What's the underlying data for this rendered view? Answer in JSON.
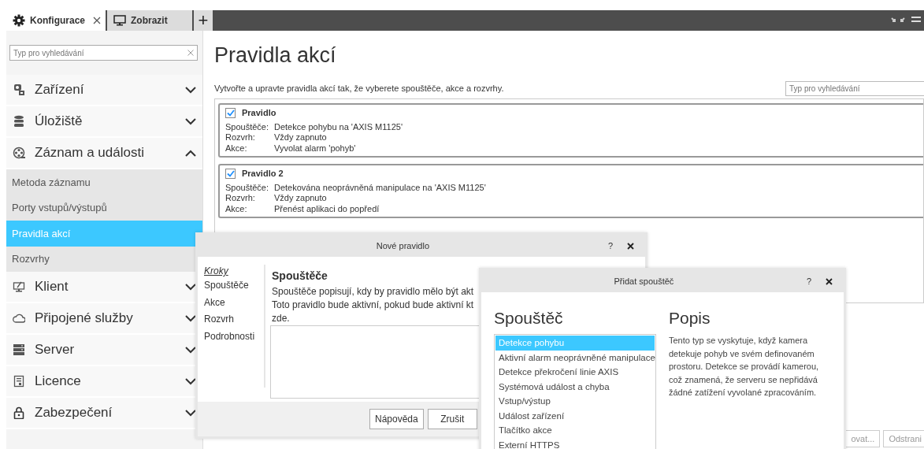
{
  "tabs": [
    {
      "label": "Konfigurace",
      "selected": true,
      "closable": true
    },
    {
      "label": "Zobrazit",
      "selected": false,
      "closable": false
    }
  ],
  "new_tab": "+",
  "sidebar": {
    "search": {
      "placeholder": "Typ pro vyhledávání"
    },
    "sections": [
      {
        "label": "Zařízení",
        "expanded": false
      },
      {
        "label": "Úložiště",
        "expanded": false
      },
      {
        "label": "Záznam a události",
        "expanded": true,
        "children": [
          {
            "label": "Metoda záznamu",
            "selected": false
          },
          {
            "label": "Porty vstupů/výstupů",
            "selected": false
          },
          {
            "label": "Pravidla akcí",
            "selected": true
          },
          {
            "label": "Rozvrhy",
            "selected": false
          }
        ]
      },
      {
        "label": "Klient",
        "expanded": false
      },
      {
        "label": "Připojené služby",
        "expanded": false
      },
      {
        "label": "Server",
        "expanded": false
      },
      {
        "label": "Licence",
        "expanded": false
      },
      {
        "label": "Zabezpečení",
        "expanded": false
      }
    ]
  },
  "main": {
    "title": "Pravidla akcí",
    "description": "Vytvořte a upravte pravidla akcí tak, že vyberete spouštěče, akce a rozvrhy.",
    "search": {
      "placeholder": "Typ pro vyhledávání"
    },
    "rules": [
      {
        "name": "Pravidlo",
        "enabled": true,
        "fields": [
          {
            "label": "Spouštěče:",
            "value": "Detekce pohybu na 'AXIS M1125'"
          },
          {
            "label": "Rozvrh:",
            "value": "Vždy zapnuto"
          },
          {
            "label": "Akce:",
            "value": "Vyvolat alarm 'pohyb'"
          }
        ]
      },
      {
        "name": "Pravidlo 2",
        "enabled": true,
        "fields": [
          {
            "label": "Spouštěče:",
            "value": "Detekována neoprávněná manipulace na 'AXIS M1125'"
          },
          {
            "label": "Rozvrh:",
            "value": "Vždy zapnuto"
          },
          {
            "label": "Akce:",
            "value": "Přenést aplikaci do popředí"
          }
        ]
      }
    ],
    "buttons": [
      "ovat...",
      "Odstrani"
    ]
  },
  "new_rule_dialog": {
    "title": "Nové pravidlo",
    "help": "?",
    "steps_heading": "Kroky",
    "steps": [
      "Spouštěče",
      "Akce",
      "Rozvrh",
      "Podrobnosti"
    ],
    "section_title": "Spouštěče",
    "description_lines": [
      "Spouštěče popisují, kdy by pravidlo mělo být akt",
      "Toto pravidlo bude aktivní, pokud bude aktivní kt",
      "zde."
    ],
    "buttons": [
      "Nápověda",
      "Zrušit"
    ]
  },
  "add_trigger_dialog": {
    "title": "Přidat spouštěč",
    "help": "?",
    "list_heading": "Spouštěč",
    "triggers": [
      {
        "label": "Detekce pohybu",
        "selected": true
      },
      {
        "label": "Aktivní alarm neoprávněné manipulace",
        "selected": false
      },
      {
        "label": "Detekce překročení linie AXIS",
        "selected": false
      },
      {
        "label": "Systémová událost a chyba",
        "selected": false
      },
      {
        "label": "Vstup/výstup",
        "selected": false
      },
      {
        "label": "Událost zařízení",
        "selected": false
      },
      {
        "label": "Tlačítko akce",
        "selected": false
      },
      {
        "label": "Externí HTTPS",
        "selected": false
      }
    ],
    "description_heading": "Popis",
    "description": "Tento typ se vyskytuje, když kamera detekuje pohyb ve svém definovaném prostoru. Detekce se provádí kamerou, což znamená, že serveru se nepřidává žádné zatížení vyvolané zpracováním."
  }
}
